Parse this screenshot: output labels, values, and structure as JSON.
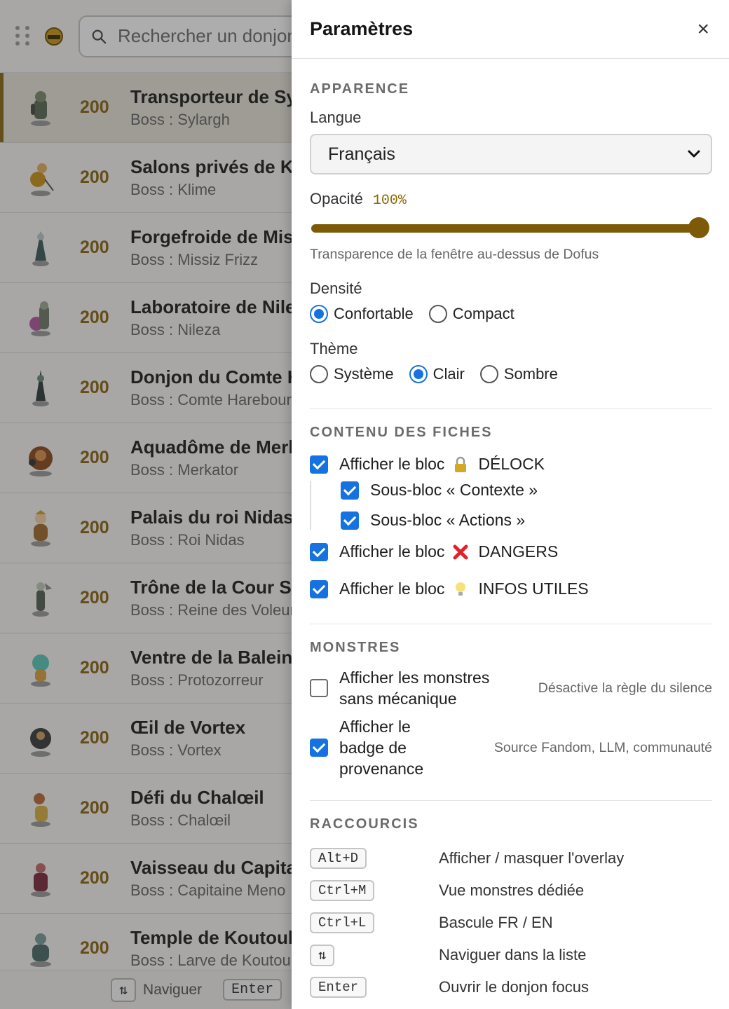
{
  "search": {
    "placeholder": "Rechercher un donjon"
  },
  "dungeons": [
    {
      "level": "200",
      "name": "Transporteur de Sylargh",
      "boss": "Boss : Sylargh"
    },
    {
      "level": "200",
      "name": "Salons privés de Klime",
      "boss": "Boss : Klime"
    },
    {
      "level": "200",
      "name": "Forgefroide de Missiz Frizz",
      "boss": "Boss : Missiz Frizz"
    },
    {
      "level": "200",
      "name": "Laboratoire de Nileza",
      "boss": "Boss : Nileza"
    },
    {
      "level": "200",
      "name": "Donjon du Comte Harebourg",
      "boss": "Boss : Comte Harebourg"
    },
    {
      "level": "200",
      "name": "Aquadôme de Merkator",
      "boss": "Boss : Merkator"
    },
    {
      "level": "200",
      "name": "Palais du roi Nidas",
      "boss": "Boss : Roi Nidas"
    },
    {
      "level": "200",
      "name": "Trône de la Cour Sombre",
      "boss": "Boss : Reine des Voleurs"
    },
    {
      "level": "200",
      "name": "Ventre de la Baleine",
      "boss": "Boss : Protozorreur"
    },
    {
      "level": "200",
      "name": "Œil de Vortex",
      "boss": "Boss : Vortex"
    },
    {
      "level": "200",
      "name": "Défi du Chalœil",
      "boss": "Boss : Chalœil"
    },
    {
      "level": "200",
      "name": "Vaisseau du Capitaine Meno",
      "boss": "Boss : Capitaine Meno"
    },
    {
      "level": "200",
      "name": "Temple de Koutoulou",
      "boss": "Boss : Larve de Koutoulou"
    }
  ],
  "bottombar": {
    "nav_label": "Naviguer",
    "enter_key": "Enter"
  },
  "settings": {
    "title": "Paramètres",
    "close": "×",
    "appearance": {
      "title": "APPARENCE",
      "language_label": "Langue",
      "language_value": "Français",
      "opacity_label": "Opacité",
      "opacity_value": "100%",
      "opacity_level": 1.0,
      "opacity_hint": "Transparence de la fenêtre au-dessus de Dofus",
      "density_label": "Densité",
      "density_options": [
        "Confortable",
        "Compact"
      ],
      "density_selected": "Confortable",
      "theme_label": "Thème",
      "theme_options": [
        "Système",
        "Clair",
        "Sombre"
      ],
      "theme_selected": "Clair"
    },
    "content": {
      "title": "CONTENU DES FICHES",
      "items": [
        {
          "prefix": "Afficher le bloc",
          "icon": "lock-icon",
          "label": "DÉLOCK",
          "checked": true
        },
        {
          "prefix": "Sous-bloc « Contexte »",
          "checked": true
        },
        {
          "prefix": "Sous-bloc « Actions »",
          "checked": true
        },
        {
          "prefix": "Afficher le bloc",
          "icon": "cross-mark-icon",
          "label": "DANGERS",
          "checked": true
        },
        {
          "prefix": "Afficher le bloc",
          "icon": "lightbulb-icon",
          "label": "INFOS UTILES",
          "checked": true
        }
      ]
    },
    "monsters": {
      "title": "MONSTRES",
      "items": [
        {
          "label_lines": [
            "Afficher les monstres",
            "sans mécanique"
          ],
          "hint": "Désactive la règle du silence",
          "checked": false
        },
        {
          "label_lines": [
            "Afficher le",
            "badge de",
            "provenance"
          ],
          "hint": "Source Fandom, LLM, communauté",
          "checked": true
        }
      ]
    },
    "shortcuts": {
      "title": "RACCOURCIS",
      "items": [
        {
          "key": "Alt+D",
          "desc": "Afficher / masquer l'overlay"
        },
        {
          "key": "Ctrl+M",
          "desc": "Vue monstres dédiée"
        },
        {
          "key": "Ctrl+L",
          "desc": "Bascule FR / EN"
        },
        {
          "key": "⇅",
          "desc": "Naviguer dans la liste"
        },
        {
          "key": "Enter",
          "desc": "Ouvrir le donjon focus"
        }
      ]
    }
  },
  "colors": {
    "accent": "#1672e0",
    "gold": "#8a6410",
    "slider": "#7d5a07"
  }
}
